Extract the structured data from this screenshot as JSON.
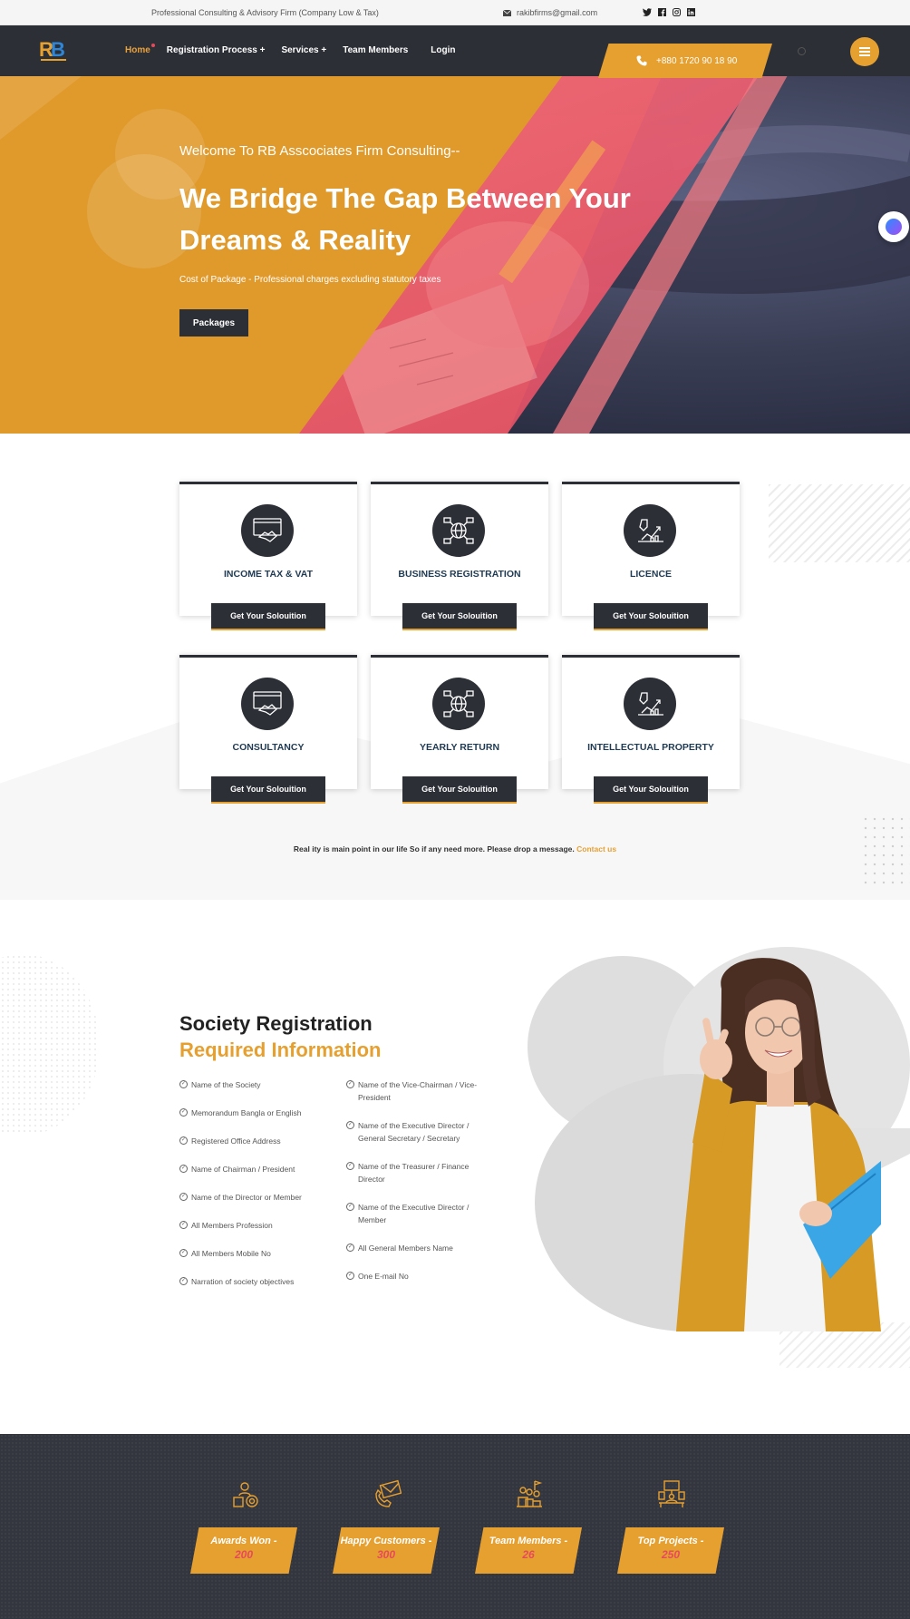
{
  "topbar": {
    "tagline": "Professional Consulting & Advisory Firm (Company Low & Tax)",
    "email": "rakibfirms@gmail.com",
    "socials": [
      "twitter-icon",
      "facebook-icon",
      "instagram-icon",
      "linkedin-icon"
    ]
  },
  "nav": {
    "items": [
      {
        "label": "Home"
      },
      {
        "label": "Registration Process +"
      },
      {
        "label": "Services +"
      },
      {
        "label": "Team Members"
      },
      {
        "label": "Login"
      }
    ],
    "phone": "+880 1720 90 18 90"
  },
  "hero": {
    "eyebrow": "Welcome To RB Asscociates Firm Consulting--",
    "title": "We Bridge The Gap Between Your Dreams & Reality",
    "subtitle": "Cost of Package - Professional charges excluding statutory taxes",
    "button": "Packages"
  },
  "services": {
    "cards": [
      {
        "title": "INCOME TAX & VAT",
        "button": "Get Your Solouition",
        "icon": "handshake-icon"
      },
      {
        "title": "BUSINESS REGISTRATION",
        "button": "Get Your Solouition",
        "icon": "network-globe-icon"
      },
      {
        "title": "LICENCE",
        "button": "Get Your Solouition",
        "icon": "growth-chart-icon"
      },
      {
        "title": "CONSULTANCY",
        "button": "Get Your Solouition",
        "icon": "handshake-icon"
      },
      {
        "title": "YEARLY RETURN",
        "button": "Get Your Solouition",
        "icon": "network-globe-icon"
      },
      {
        "title": "INTELLECTUAL PROPERTY",
        "button": "Get Your Solouition",
        "icon": "growth-chart-icon"
      }
    ],
    "note": "Real ity is main point in our life So if any need more. Please drop a message.",
    "contact_link": "Contact us"
  },
  "society": {
    "title": "Society Registration",
    "subtitle": "Required Information",
    "left": [
      "Name of the Society",
      "Memorandum Bangla or English",
      "Registered Office Address",
      "Name of Chairman / President",
      "Name of the Director or Member",
      "All Members Profession",
      "All Members Mobile No",
      "Narration of society objectives"
    ],
    "right": [
      "Name of the Vice-Chairman / Vice-President",
      "Name of the Executive Director / General Secretary / Secretary",
      "Name of the Treasurer / Finance Director",
      "Name of the Executive Director / Member",
      "All General Members Name",
      "One E-mail No"
    ]
  },
  "stats": [
    {
      "label": "Awards Won -",
      "value": "200",
      "icon": "award-icon"
    },
    {
      "label": "Happy Customers -",
      "value": "300",
      "icon": "phone-mail-icon"
    },
    {
      "label": "Team Members -",
      "value": "26",
      "icon": "team-icon"
    },
    {
      "label": "Top Projects -",
      "value": "250",
      "icon": "desk-computer-icon"
    }
  ],
  "colors": {
    "accent": "#e6a030",
    "dark": "#2d2f37",
    "pink": "#e5586c"
  }
}
